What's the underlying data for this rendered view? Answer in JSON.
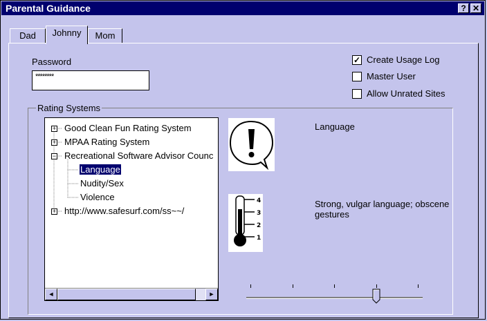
{
  "window": {
    "title": "Parental Guidance",
    "help_button": "?",
    "close_button": "✕"
  },
  "tabs": [
    {
      "label": "Dad"
    },
    {
      "label": "Johnny",
      "selected": true
    },
    {
      "label": "Mom"
    }
  ],
  "password": {
    "label": "Password",
    "value": "********"
  },
  "options": [
    {
      "label": "Create Usage Log",
      "checked": true
    },
    {
      "label": "Master User",
      "checked": false
    },
    {
      "label": "Allow Unrated Sites",
      "checked": false
    }
  ],
  "rating_systems": {
    "group_label": "Rating Systems",
    "tree": [
      {
        "label": "Good Clean Fun Rating System",
        "expander": "+"
      },
      {
        "label": "MPAA Rating System",
        "expander": "+"
      },
      {
        "label": "Recreational Software Advisor Counc",
        "expander": "−"
      },
      {
        "label": "Language",
        "selected": true
      },
      {
        "label": "Nudity/Sex"
      },
      {
        "label": "Violence"
      },
      {
        "label": "http://www.safesurf.com/ss~~/",
        "expander": "+"
      }
    ],
    "scroll_left": "◄",
    "scroll_right": "►"
  },
  "detail": {
    "category_name": "Language",
    "category_icon": "exclamation-speech-bubble-icon",
    "level_description": "Strong, vulgar language; obscene gestures",
    "thermometer_icon": "thermometer-icon",
    "thermometer_scale": [
      "4",
      "3",
      "2",
      "1"
    ],
    "slider_positions": 5,
    "slider_value": 4
  },
  "colors": {
    "titlebar": "#00006e",
    "face": "#c4c4ec",
    "selection": "#00006e"
  }
}
